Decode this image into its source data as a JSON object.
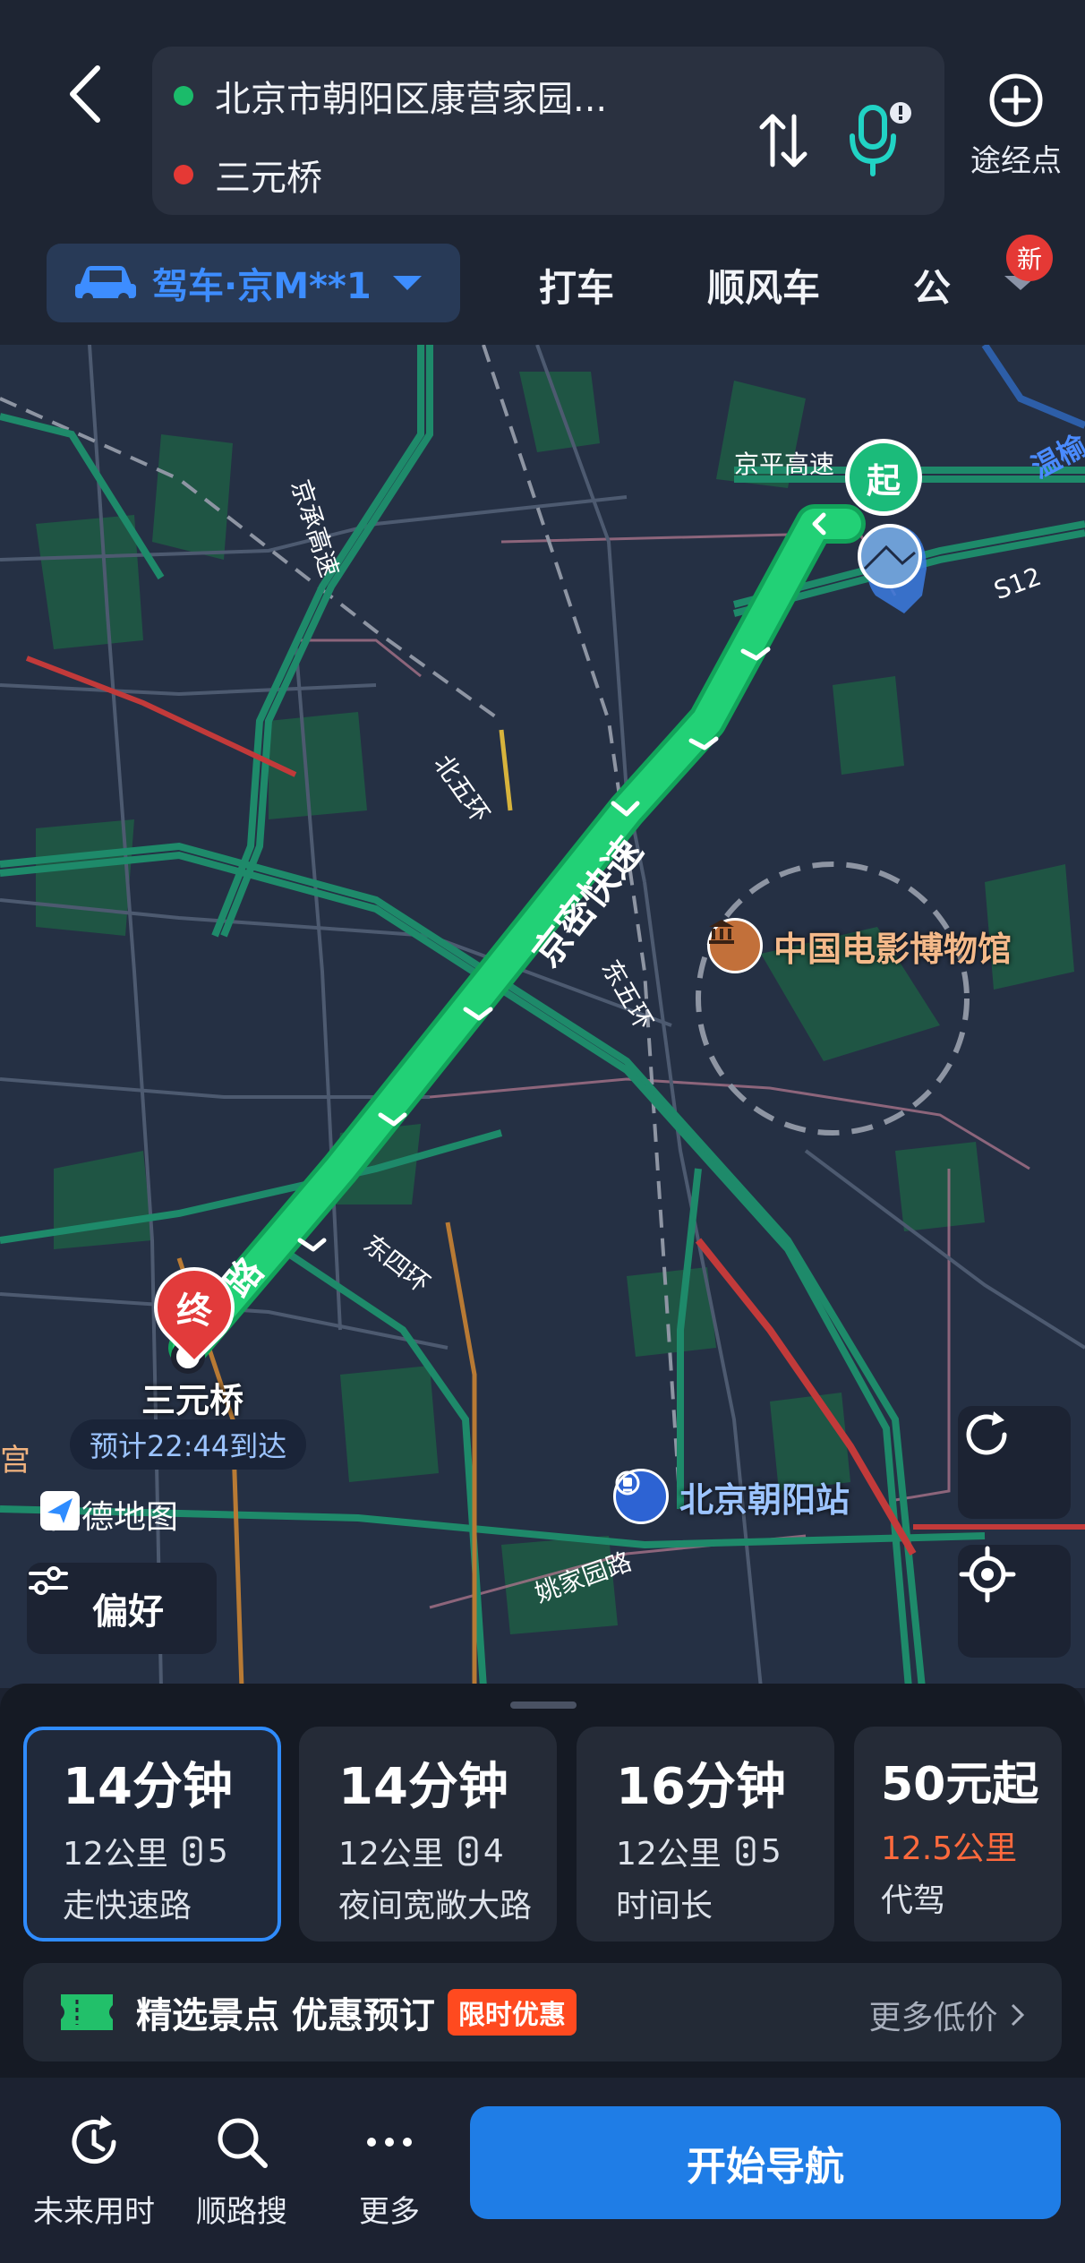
{
  "header": {
    "origin": "北京市朝阳区康营家园...",
    "destination": "三元桥",
    "waypoint_label": "途经点"
  },
  "modes": {
    "drive_label": "驾车·京M**1",
    "taxi_label": "打车",
    "carpool_label": "顺风车",
    "transit_label": "公",
    "new_badge": "新"
  },
  "map": {
    "start_label": "起",
    "end_label": "终",
    "destination_label": "三元桥",
    "eta": "预计22:44到达",
    "road_labels": [
      "京平高速",
      "京承高速",
      "S12",
      "北五环",
      "京密快速",
      "东五环",
      "东四环",
      "姚家园路",
      "温榆",
      "宫",
      "路"
    ],
    "poi_museum": "中国电影博物馆",
    "poi_station": "北京朝阳站",
    "logo_text": "高德地图",
    "preference_label": "偏好"
  },
  "routes": [
    {
      "time": "14分钟",
      "distance": "12公里",
      "lights": "5",
      "tag": "走快速路",
      "selected": true
    },
    {
      "time": "14分钟",
      "distance": "12公里",
      "lights": "4",
      "tag": "夜间宽敞大路",
      "selected": false
    },
    {
      "time": "16分钟",
      "distance": "12公里",
      "lights": "5",
      "tag": "时间长",
      "selected": false
    },
    {
      "time": "50元起",
      "distance": "12.5公里",
      "lights": "",
      "tag": "代驾",
      "selected": false
    }
  ],
  "promo": {
    "title": "精选景点 优惠预订",
    "badge": "限时优惠",
    "more": "更多低价"
  },
  "bottom_bar": {
    "future_label": "未来用时",
    "along_search_label": "顺路搜",
    "more_label": "更多",
    "start_nav_label": "开始导航"
  },
  "colors": {
    "accent_blue": "#1f7de6",
    "route_green": "#20c86a",
    "end_red": "#e23b3b",
    "highlight_orange": "#ff6a3d"
  }
}
